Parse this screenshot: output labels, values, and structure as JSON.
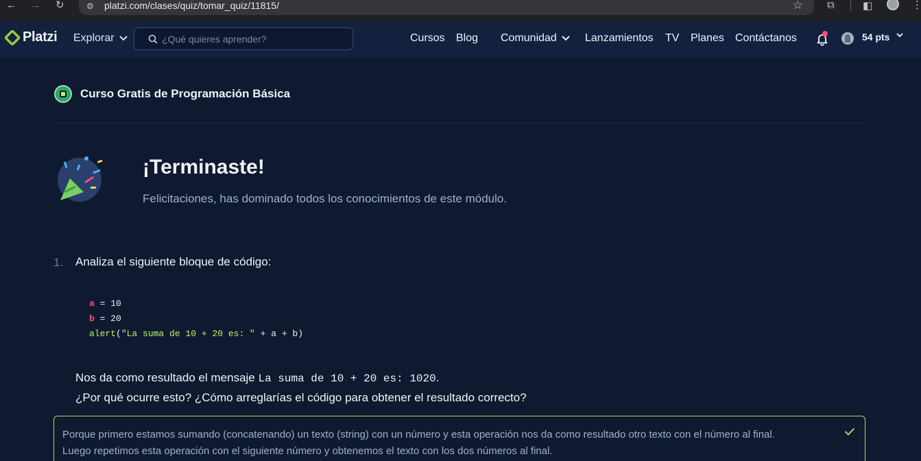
{
  "browser": {
    "url": "platzi.com/clases/quiz/tomar_quiz/11815/",
    "back_icon": "←",
    "forward_icon": "→",
    "reload_icon": "↻",
    "star_icon": "☆",
    "ext_icon": "⧉",
    "sidepanel_icon": "◧",
    "menu_icon": "⋮",
    "site_icon": "⚙"
  },
  "header": {
    "logo_text": "Platzi",
    "explore_label": "Explorar",
    "search_placeholder": "¿Qué quieres aprender?",
    "nav": {
      "cursos": "Cursos",
      "blog": "Blog",
      "comunidad": "Comunidad",
      "lanzamientos": "Lanzamientos",
      "tv": "TV",
      "planes": "Planes",
      "contactanos": "Contáctanos"
    },
    "points": "54 pts"
  },
  "course": {
    "title": "Curso Gratis de Programación Básica"
  },
  "result": {
    "title": "¡Terminaste!",
    "subtitle": "Felicitaciones, has dominado todos los conocimientos de este módulo."
  },
  "question": {
    "number": "1.",
    "prompt": "Analiza el siguiente bloque de código:",
    "code": {
      "line1_var": "a",
      "line1_rest": " = 10",
      "line2_var": "b",
      "line2_rest": " = 20",
      "line3_fn": "alert",
      "line3_open": "(",
      "line3_str": "\"La suma de 10 + 20 es: \"",
      "line3_rest": " + a + b)"
    },
    "body_prefix": "Nos da como resultado el mensaje ",
    "body_code": "La suma de 10 + 20 es: 1020",
    "body_suffix": ".",
    "body_line2": "¿Por qué ocurre esto? ¿Cómo arreglarías el código para obtener el resultado correcto?"
  },
  "answer": {
    "line1": "Porque primero estamos sumando (concatenando) un texto (string) con un número y esta operación nos da como resultado otro texto con el número al final.",
    "line2": "Luego repetimos esta operación con el siguiente número y obtenemos el texto con los dos números al final.",
    "check_color": "#b5d66a"
  },
  "colors": {
    "background": "#0f1a30",
    "header": "#13213f",
    "accent": "#2ea866",
    "code_var": "#ff4b7d",
    "code_string": "#b9f36c"
  }
}
